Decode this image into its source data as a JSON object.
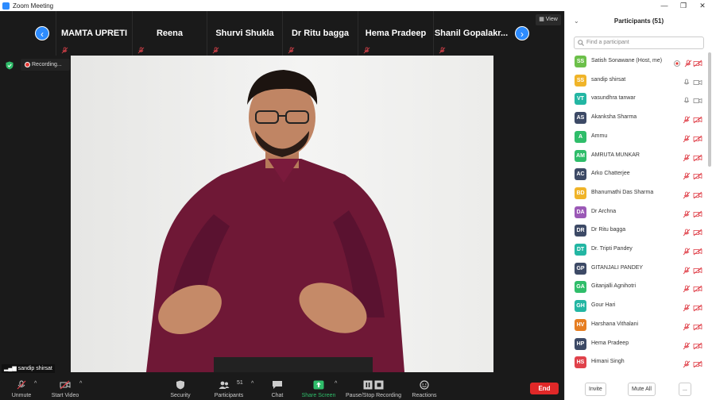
{
  "window": {
    "title": "Zoom Meeting"
  },
  "gallery": {
    "tiles": [
      {
        "name": "MAMTA UPRETI"
      },
      {
        "name": "Reena"
      },
      {
        "name": "Shurvi Shukla"
      },
      {
        "name": "Dr Ritu bagga"
      },
      {
        "name": "Hema Pradeep"
      },
      {
        "name": "Shanil  Gopalakr..."
      }
    ],
    "view_label": "View"
  },
  "recording": {
    "label": "Recording..."
  },
  "self_view": {
    "name": "sandip shirsat"
  },
  "toolbar": {
    "unmute": "Unmute",
    "start_video": "Start Video",
    "security": "Security",
    "participants": "Participants",
    "participants_count": "51",
    "chat": "Chat",
    "share_screen": "Share Screen",
    "pause_stop_recording": "Pause/Stop Recording",
    "reactions": "Reactions",
    "end": "End"
  },
  "panel": {
    "title": "Participants (51)",
    "search_placeholder": "Find a participant",
    "participants": [
      {
        "initials": "SS",
        "name": "Satish Sonawane (Host, me)",
        "color": "#6cc04a"
      },
      {
        "initials": "SS",
        "name": "sandip shirsat",
        "color": "#f0b429"
      },
      {
        "initials": "VT",
        "name": "vasundhra tanwar",
        "color": "#23b6a3"
      },
      {
        "initials": "AS",
        "name": "Akanksha Sharma",
        "color": "#3d4a66"
      },
      {
        "initials": "A",
        "name": "Ammu",
        "color": "#2fbd6a"
      },
      {
        "initials": "AM",
        "name": "AMRUTA MUNKAR",
        "color": "#2fbd6a"
      },
      {
        "initials": "AC",
        "name": "Arko Chatterjee",
        "color": "#3d4a66"
      },
      {
        "initials": "BD",
        "name": "Bhanumathi Das Sharma",
        "color": "#f0b429"
      },
      {
        "initials": "DA",
        "name": "Dr Archna",
        "color": "#9b59b6"
      },
      {
        "initials": "DR",
        "name": "Dr Ritu bagga",
        "color": "#3d4a66"
      },
      {
        "initials": "DT",
        "name": "Dr. Tripti Pandey",
        "color": "#23b6a3"
      },
      {
        "initials": "GP",
        "name": "GITANJALI PANDEY",
        "color": "#3d4a66"
      },
      {
        "initials": "GA",
        "name": "Gitanjalli Agnihotri",
        "color": "#2fbd6a"
      },
      {
        "initials": "GH",
        "name": "Gour Hari",
        "color": "#23b6a3"
      },
      {
        "initials": "HV",
        "name": "Harshana Vithalani",
        "color": "#e67e22"
      },
      {
        "initials": "HP",
        "name": "Hema Pradeep",
        "color": "#3d4a66"
      },
      {
        "initials": "HS",
        "name": "Himani Singh",
        "color": "#e0424b"
      }
    ],
    "invite": "Invite",
    "mute_all": "Mute All",
    "more": "..."
  },
  "colors": {
    "accent": "#2d8cff",
    "end": "#e02828",
    "muted": "#e0424b"
  }
}
